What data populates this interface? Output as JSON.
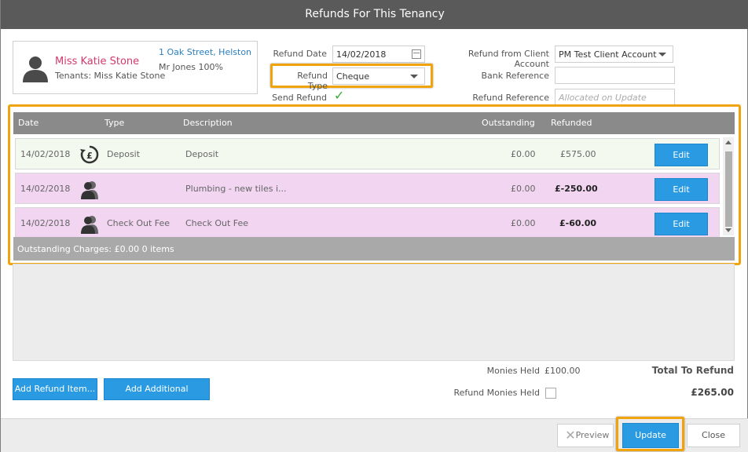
{
  "window": {
    "title": "Refunds For This Tenancy"
  },
  "tenant": {
    "name": "Miss Katie Stone",
    "tenants_line": "Tenants: Miss Katie Stone",
    "address": "1 Oak Street, Helston",
    "landlord": "Mr Jones 100%"
  },
  "form": {
    "refund_date_label": "Refund Date",
    "refund_date_value": "14/02/2018",
    "refund_type_label": "Refund Type",
    "refund_type_value": "Cheque",
    "send_refund_label": "Send Refund",
    "send_refund_checked": true,
    "client_account_label": "Refund from Client Account",
    "client_account_value": "PM Test Client Account",
    "bank_reference_label": "Bank Reference",
    "bank_reference_value": "",
    "refund_reference_label": "Refund Reference",
    "refund_reference_placeholder": "Allocated on Update"
  },
  "grid": {
    "columns": [
      "Date",
      "Type",
      "Description",
      "Outstanding",
      "Refunded"
    ],
    "rows": [
      {
        "date": "14/02/2018",
        "type_icon": "deposit-pound-icon",
        "type": "Deposit",
        "description": "Deposit",
        "outstanding": "£0.00",
        "refunded": "£575.00",
        "edit": "Edit",
        "bg": "#f4f9ef"
      },
      {
        "date": "14/02/2018",
        "type_icon": "person-icon",
        "type": "",
        "description": "Plumbing - new tiles i...",
        "outstanding": "£0.00",
        "refunded": "£-250.00",
        "edit": "Edit",
        "bg": "#f1d5f1"
      },
      {
        "date": "14/02/2018",
        "type_icon": "person-icon",
        "type": "Check Out Fee",
        "description": "Check Out Fee",
        "outstanding": "£0.00",
        "refunded": "£-60.00",
        "edit": "Edit",
        "bg": "#f1d5f1"
      }
    ],
    "footer": "Outstanding Charges: £0.00 0 items"
  },
  "summary": {
    "monies_held_label": "Monies Held",
    "monies_held_value": "£100.00",
    "refund_monies_held_label": "Refund Monies Held",
    "total_label": "Total To Refund",
    "total_value": "£265.00"
  },
  "actions": {
    "add_refund_item": "Add Refund Item...",
    "add_additional_charge": "Add Additional Charge...",
    "preview": "Preview",
    "update": "Update",
    "close": "Close"
  },
  "colors": {
    "accent": "#2a9be3",
    "highlight": "#f0a30a",
    "name": "#d13a6b",
    "link": "#2a7fc1"
  }
}
